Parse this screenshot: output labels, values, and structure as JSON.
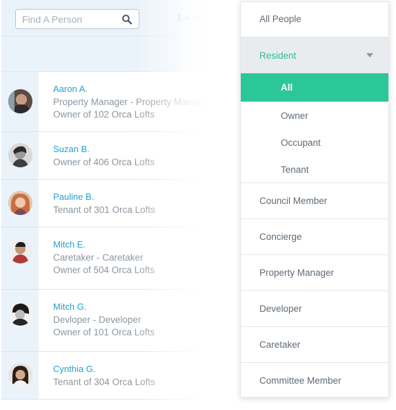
{
  "search": {
    "placeholder": "Find A Person"
  },
  "pagination": {
    "count_text": "1-4 of"
  },
  "people": [
    {
      "name": "Aaron A.",
      "lines": [
        "Property Manager - Property Manag",
        "Owner of 102 Orca Lofts"
      ]
    },
    {
      "name": "Suzan B.",
      "lines": [
        "Owner of 406 Orca Lofts"
      ]
    },
    {
      "name": "Pauline B.",
      "lines": [
        "Tenant of 301 Orca Lofts"
      ]
    },
    {
      "name": "Mitch E.",
      "lines": [
        "Caretaker - Caretaker",
        "Owner of 504 Orca Lofts"
      ]
    },
    {
      "name": "Mitch G.",
      "lines": [
        "Devloper - Developer",
        "Owner of 101 Orca Lofts"
      ]
    },
    {
      "name": "Cynthia G.",
      "lines": [
        "Tenant of 304 Orca Lofts"
      ]
    }
  ],
  "filter_menu": {
    "all_people": "All People",
    "resident": "Resident",
    "resident_sub": [
      "All",
      "Owner",
      "Occupant",
      "Tenant"
    ],
    "selected_sub": "All",
    "roles": [
      "Council Member",
      "Concierge",
      "Property Manager",
      "Developer",
      "Caretaker",
      "Committee Member"
    ]
  },
  "colors": {
    "accent_green": "#2cc799",
    "link_blue": "#1fa3cf",
    "header_blue": "#eaf2fa"
  },
  "icons": {
    "search": "search-icon",
    "caret": "caret-down-icon"
  }
}
